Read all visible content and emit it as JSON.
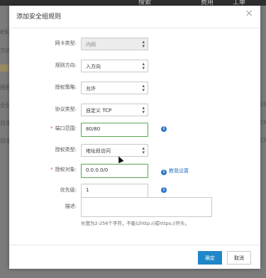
{
  "background": {
    "top_items": [
      "搜索",
      "费用",
      "工单"
    ],
    "side_left": [
      "eky",
      "方向",
      "授权",
      "全部",
      "自定",
      "自定"
    ],
    "side_right": [
      "03:",
      "03:",
      "03:"
    ]
  },
  "dialog": {
    "title": "添加安全组规则",
    "close_icon": "×",
    "fields": {
      "nic_type": {
        "label": "网卡类型:",
        "value": "内网"
      },
      "direction": {
        "label": "规则方向:",
        "value": "入方向"
      },
      "policy": {
        "label": "授权策略:",
        "value": "允许"
      },
      "protocol": {
        "label": "协议类型:",
        "value": "自定义 TCP"
      },
      "port_range": {
        "label": "端口范围:",
        "value": "80/80",
        "required": "*"
      },
      "auth_type": {
        "label": "授权类型:",
        "value": "地址段访问"
      },
      "auth_object": {
        "label": "授权对象:",
        "value": "0.0.0.0/0",
        "required": "*",
        "link": "教我设置"
      },
      "priority": {
        "label": "优先级:",
        "value": "1"
      },
      "description": {
        "label": "描述:",
        "value": "",
        "hint": "长度为2-256个字符，不能以http://或https://开头。"
      }
    },
    "info_icon": "i",
    "buttons": {
      "confirm": "确定",
      "cancel": "取消"
    }
  }
}
